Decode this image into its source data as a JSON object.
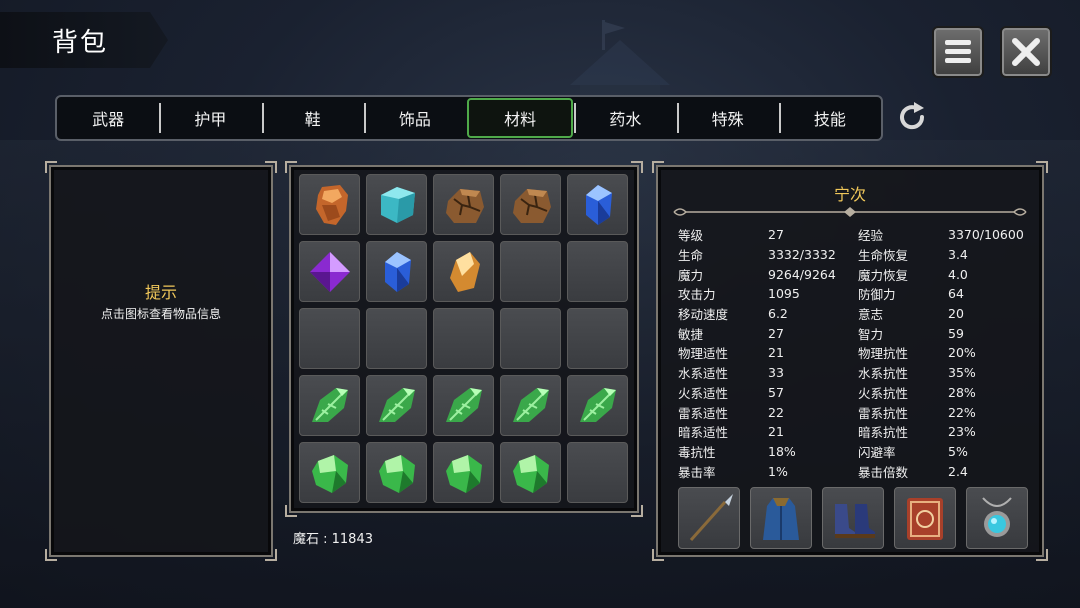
{
  "header": {
    "title": "背包"
  },
  "tabs": [
    "武器",
    "护甲",
    "鞋",
    "饰品",
    "材料",
    "药水",
    "特殊",
    "技能"
  ],
  "active_tab": "材料",
  "hint": {
    "title": "提示",
    "text": "点击图标查看物品信息"
  },
  "inventory": {
    "slots": [
      "copper-ore-icon",
      "ice-cube-icon",
      "cracked-rock-icon",
      "cracked-rock-icon",
      "blue-gem-icon",
      "purple-crystal-icon",
      "blue-gem-icon",
      "amber-crystal-icon",
      "",
      "",
      "",
      "",
      "",
      "",
      "",
      "green-leaf-crystal-icon",
      "green-leaf-crystal-icon",
      "green-leaf-crystal-icon",
      "green-leaf-crystal-icon",
      "green-leaf-crystal-icon",
      "green-jade-icon",
      "green-jade-icon",
      "green-jade-icon",
      "green-jade-icon",
      ""
    ]
  },
  "currency": {
    "text": "魔石 : 11843"
  },
  "character": {
    "name": "宁次",
    "stats": [
      [
        "等级",
        "27",
        "经验",
        "3370/10600"
      ],
      [
        "生命",
        "3332/3332",
        "生命恢复",
        "3.4"
      ],
      [
        "魔力",
        "9264/9264",
        "魔力恢复",
        "4.0"
      ],
      [
        "攻击力",
        "1095",
        "防御力",
        "64"
      ],
      [
        "移动速度",
        "6.2",
        "意志",
        "20"
      ],
      [
        "敏捷",
        "27",
        "智力",
        "59"
      ],
      [
        "物理适性",
        "21",
        "物理抗性",
        "20%"
      ],
      [
        "水系适性",
        "33",
        "水系抗性",
        "35%"
      ],
      [
        "火系适性",
        "57",
        "火系抗性",
        "28%"
      ],
      [
        "雷系适性",
        "22",
        "雷系抗性",
        "22%"
      ],
      [
        "暗系适性",
        "21",
        "暗系抗性",
        "23%"
      ],
      [
        "毒抗性",
        "18%",
        "闪避率",
        "5%"
      ],
      [
        "暴击率",
        "1%",
        "暴击倍数",
        "2.4"
      ]
    ],
    "equipment": [
      "spear-icon",
      "robe-icon",
      "boots-icon",
      "spellbook-icon",
      "amulet-icon"
    ]
  },
  "colors": {
    "accent_gold": "#f1c85a",
    "active_tab_border": "#4faa4a"
  }
}
